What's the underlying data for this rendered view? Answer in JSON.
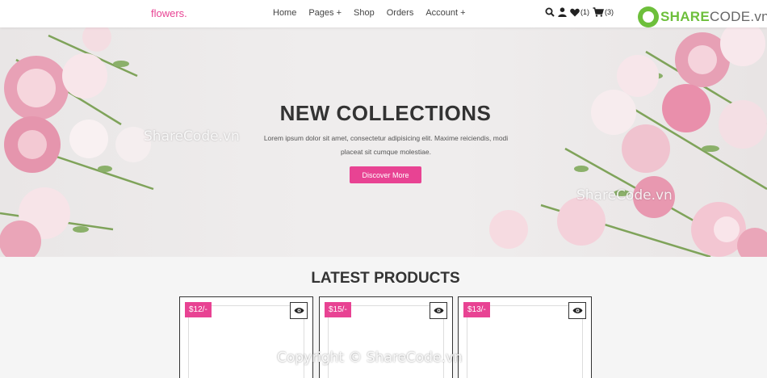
{
  "header": {
    "logo": "flowers.",
    "nav": [
      "Home",
      "Pages +",
      "Shop",
      "Orders",
      "Account +"
    ],
    "wishlist_count": "(1)",
    "cart_count": "(3)"
  },
  "watermark": {
    "logo_main": "SHARE",
    "logo_rest": "CODE.vn",
    "text_left": "ShareCode.vn",
    "text_right": "ShareCode.vn",
    "copyright": "Copyright © ShareCode.vn"
  },
  "hero": {
    "title": "NEW COLLECTIONS",
    "text": "Lorem ipsum dolor sit amet, consectetur adipisicing elit. Maxime reiciendis, modi placeat sit cumque molestiae.",
    "button": "Discover More"
  },
  "products": {
    "title": "LATEST PRODUCTS",
    "items": [
      {
        "price": "$12/-"
      },
      {
        "price": "$15/-"
      },
      {
        "price": "$13/-"
      }
    ]
  },
  "colors": {
    "accent": "#e84393",
    "text": "#333333"
  },
  "icons": [
    "search-icon",
    "user-icon",
    "heart-icon",
    "cart-icon",
    "eye-icon"
  ]
}
